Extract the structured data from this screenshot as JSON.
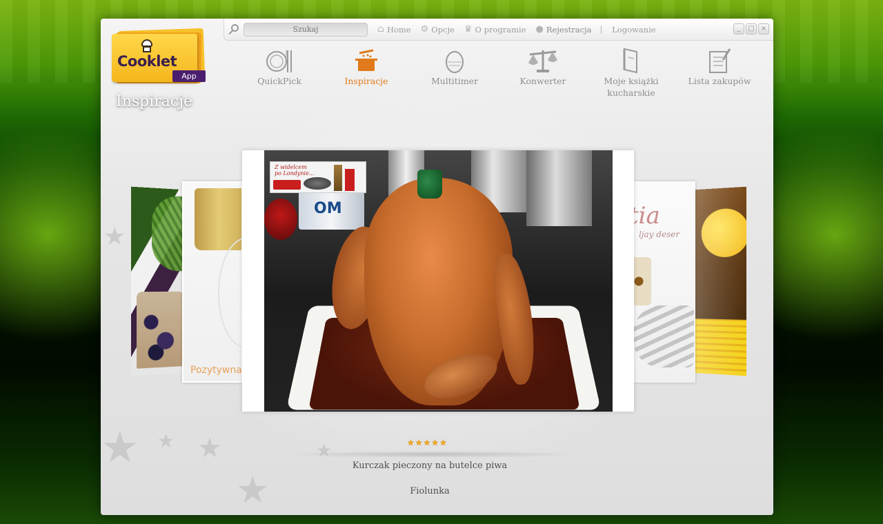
{
  "toolbar": {
    "search_placeholder": "Szukaj",
    "home": "Home",
    "options": "Opcje",
    "about": "O programie",
    "register": "Rejestracja",
    "separator": "|",
    "login": "Logowanie",
    "icons": [
      "search-icon",
      "home-icon",
      "gears-icon",
      "chef-hat-icon",
      "user-icon"
    ],
    "window_controls": {
      "minimize": "_",
      "maximize": "□",
      "close": "×"
    }
  },
  "logo": {
    "word": "Cooklet",
    "app_badge": "App",
    "colors": {
      "yellow": "#f4b61c",
      "purple": "#4b1f6f"
    }
  },
  "section_title": "Inspiracje",
  "nav": {
    "items": [
      {
        "label": "QuickPick",
        "icon": "plate-fork-knife-icon",
        "active": false
      },
      {
        "label": "Inspiracje",
        "icon": "cooking-pot-icon",
        "active": true
      },
      {
        "label": "Multitimer",
        "icon": "egg-timer-icon",
        "active": false
      },
      {
        "label": "Konwerter",
        "icon": "scales-icon",
        "active": false
      },
      {
        "label": "Moje książki kucharskie",
        "icon": "cookbook-icon",
        "active": false
      },
      {
        "label": "Lista zakupów",
        "icon": "shopping-list-icon",
        "active": false
      }
    ],
    "active_color": "#e07a1a"
  },
  "carousel": {
    "left_card_signature": "Pozytywna",
    "right_card_word": "tia",
    "right_card_sub": "ljay deser",
    "main_photo": {
      "badge_text_line1": "Z widelcem",
      "badge_text_line2": "po Londynie...",
      "mug_text": "OM"
    }
  },
  "recipe": {
    "rating": 5,
    "rating_max": 5,
    "title": "Kurczak pieczony na butelce piwa",
    "author": "Fiolunka"
  }
}
